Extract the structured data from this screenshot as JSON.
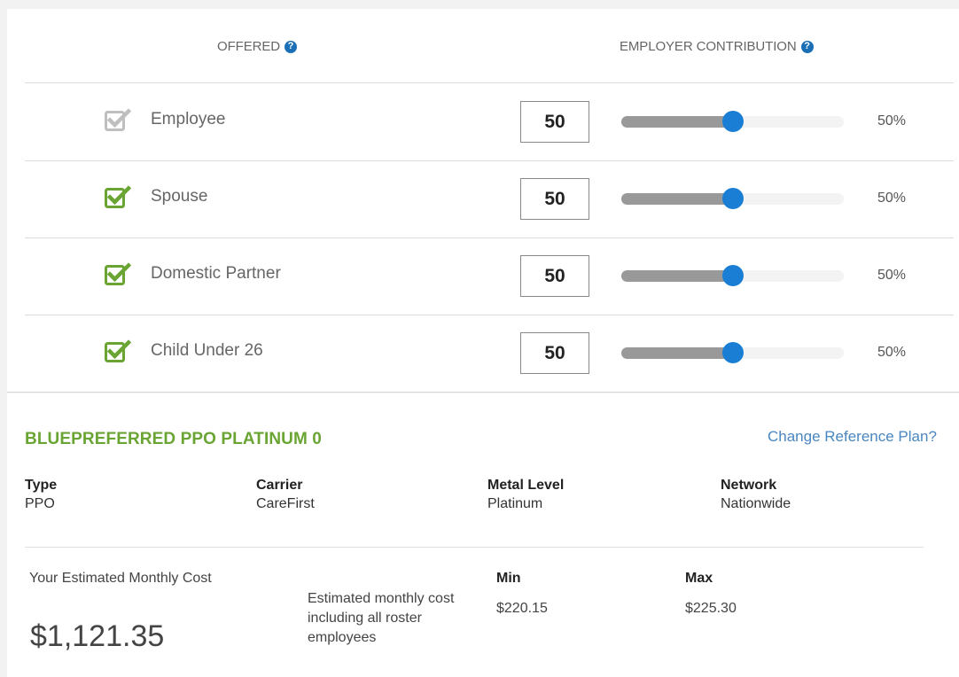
{
  "header": {
    "offered_label": "OFFERED",
    "contribution_label": "EMPLOYER CONTRIBUTION"
  },
  "rows": [
    {
      "label": "Employee",
      "checked": true,
      "disabled": true,
      "value": "50",
      "percent": "50%",
      "slider_fraction": 0.5
    },
    {
      "label": "Spouse",
      "checked": true,
      "disabled": false,
      "value": "50",
      "percent": "50%",
      "slider_fraction": 0.5
    },
    {
      "label": "Domestic Partner",
      "checked": true,
      "disabled": false,
      "value": "50",
      "percent": "50%",
      "slider_fraction": 0.5
    },
    {
      "label": "Child Under 26",
      "checked": true,
      "disabled": false,
      "value": "50",
      "percent": "50%",
      "slider_fraction": 0.5
    }
  ],
  "plan": {
    "name": "BLUEPREFERRED PPO PLATINUM 0",
    "change_link": "Change Reference Plan?",
    "type_label": "Type",
    "type_value": "PPO",
    "carrier_label": "Carrier",
    "carrier_value": "CareFirst",
    "metal_label": "Metal Level",
    "metal_value": "Platinum",
    "network_label": "Network",
    "network_value": "Nationwide"
  },
  "cost": {
    "label": "Your Estimated Monthly Cost",
    "value": "$1,121.35",
    "description": "Estimated monthly cost including all roster employees",
    "min_label": "Min",
    "min_value": "$220.15",
    "max_label": "Max",
    "max_value": "$225.30"
  },
  "colors": {
    "check_green": "#6aa534",
    "check_disabled": "#bfbfbf",
    "accent_blue": "#1a7fd4",
    "link_blue": "#4a86c0"
  },
  "icons": {
    "help": "help-circle-icon",
    "checkbox": "checkbox-checked-icon"
  }
}
